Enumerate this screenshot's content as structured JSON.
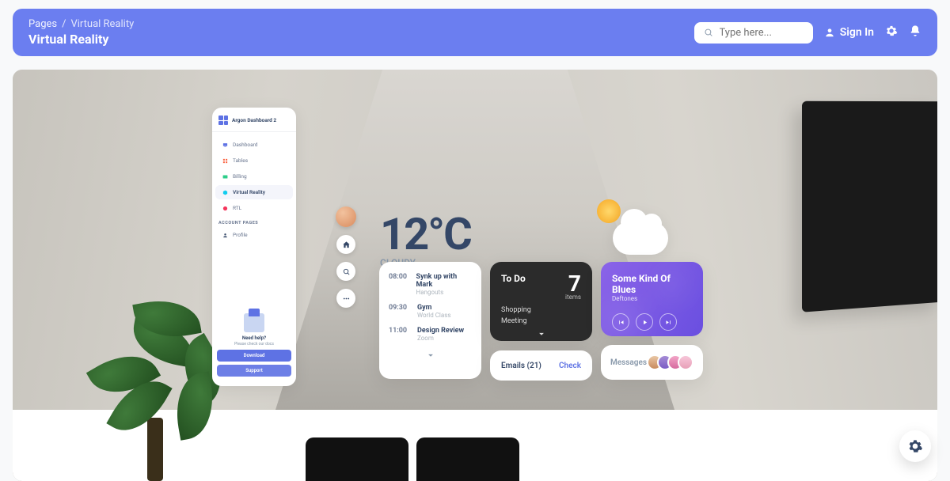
{
  "breadcrumb": {
    "root": "Pages",
    "sep": "/",
    "leaf": "Virtual Reality"
  },
  "page_title": "Virtual Reality",
  "search": {
    "placeholder": "Type here..."
  },
  "topbar": {
    "signin": "Sign In"
  },
  "sidebar": {
    "brand": "Argon Dashboard 2",
    "items": [
      {
        "label": "Dashboard",
        "color": "#5e72e4"
      },
      {
        "label": "Tables",
        "color": "#fb6340"
      },
      {
        "label": "Billing",
        "color": "#2dce89"
      },
      {
        "label": "Virtual Reality",
        "color": "#11cdef"
      },
      {
        "label": "RTL",
        "color": "#f5365c"
      }
    ],
    "section": "ACCOUNT PAGES",
    "account_items": [
      {
        "label": "Profile"
      }
    ],
    "need_title": "Need help?",
    "need_sub": "Please check our docs",
    "download": "Download",
    "support": "Support"
  },
  "weather": {
    "temp": "12°C",
    "desc": "CLOUDY"
  },
  "schedule": [
    {
      "time": "08:00",
      "title": "Synk up with Mark",
      "sub": "Hangouts"
    },
    {
      "time": "09:30",
      "title": "Gym",
      "sub": "World Class"
    },
    {
      "time": "11:00",
      "title": "Design Review",
      "sub": "Zoom"
    }
  ],
  "todo": {
    "heading": "To Do",
    "count": "7",
    "items_label": "items",
    "list": [
      "Shopping",
      "Meeting"
    ]
  },
  "music": {
    "title": "Some Kind Of Blues",
    "artist": "Deftones"
  },
  "emails": {
    "label": "Emails (21)",
    "action": "Check"
  },
  "messages": {
    "label": "Messages"
  }
}
